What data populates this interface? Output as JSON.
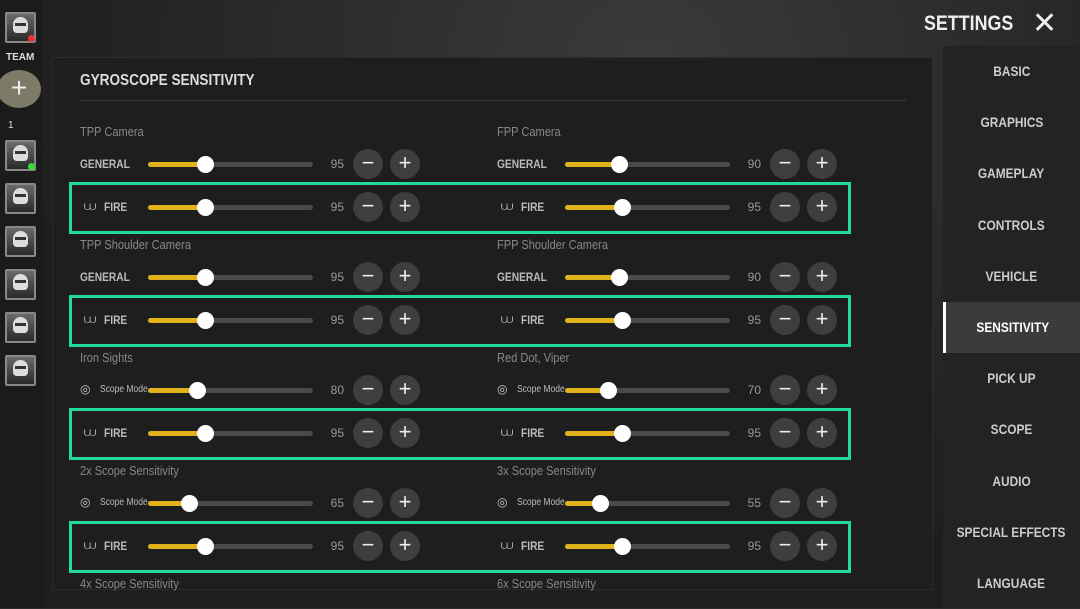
{
  "header": {
    "title": "SETTINGS",
    "close_icon": "close-icon"
  },
  "team": {
    "label": "TEAM",
    "add_label": "+",
    "count": "1"
  },
  "panel_title": "GYROSCOPE SENSITIVITY",
  "slider_max": 300,
  "accent": "#e0b21c",
  "highlight": "#22d9a0",
  "sections": [
    {
      "title": "TPP Camera",
      "side": "left",
      "rows": [
        {
          "label": "GENERAL",
          "icon": "",
          "value": 95
        },
        {
          "label": "FIRE",
          "icon": "fire-icon",
          "value": 95
        }
      ]
    },
    {
      "title": "FPP Camera",
      "side": "right",
      "rows": [
        {
          "label": "GENERAL",
          "icon": "",
          "value": 90
        },
        {
          "label": "FIRE",
          "icon": "fire-icon",
          "value": 95
        }
      ]
    },
    {
      "title": "TPP Shoulder Camera",
      "side": "left",
      "rows": [
        {
          "label": "GENERAL",
          "icon": "",
          "value": 95
        },
        {
          "label": "FIRE",
          "icon": "fire-icon",
          "value": 95
        }
      ]
    },
    {
      "title": "FPP Shoulder Camera",
      "side": "right",
      "rows": [
        {
          "label": "GENERAL",
          "icon": "",
          "value": 90
        },
        {
          "label": "FIRE",
          "icon": "fire-icon",
          "value": 95
        }
      ]
    },
    {
      "title": "Iron Sights",
      "side": "left",
      "rows": [
        {
          "label": "Scope Mode",
          "icon": "scope-icon",
          "value": 80
        },
        {
          "label": "FIRE",
          "icon": "fire-icon",
          "value": 95
        }
      ]
    },
    {
      "title": "Red Dot, Viper",
      "side": "right",
      "rows": [
        {
          "label": "Scope Mode",
          "icon": "scope-icon",
          "value": 70
        },
        {
          "label": "FIRE",
          "icon": "fire-icon",
          "value": 95
        }
      ]
    },
    {
      "title": "2x Scope Sensitivity",
      "side": "left",
      "rows": [
        {
          "label": "Scope Mode",
          "icon": "scope-icon",
          "value": 65
        },
        {
          "label": "FIRE",
          "icon": "fire-icon",
          "value": 95
        }
      ]
    },
    {
      "title": "3x Scope Sensitivity",
      "side": "right",
      "rows": [
        {
          "label": "Scope Mode",
          "icon": "scope-icon",
          "value": 55
        },
        {
          "label": "FIRE",
          "icon": "fire-icon",
          "value": 95
        }
      ]
    },
    {
      "title": "4x Scope Sensitivity",
      "side": "left",
      "rows": []
    },
    {
      "title": "6x Scope Sensitivity",
      "side": "right",
      "rows": []
    }
  ],
  "nav": [
    {
      "label": "BASIC"
    },
    {
      "label": "GRAPHICS"
    },
    {
      "label": "GAMEPLAY"
    },
    {
      "label": "CONTROLS"
    },
    {
      "label": "VEHICLE"
    },
    {
      "label": "SENSITIVITY",
      "active": true
    },
    {
      "label": "PICK UP"
    },
    {
      "label": "SCOPE"
    },
    {
      "label": "AUDIO"
    },
    {
      "label": "SPECIAL EFFECTS"
    },
    {
      "label": "LANGUAGE"
    }
  ]
}
